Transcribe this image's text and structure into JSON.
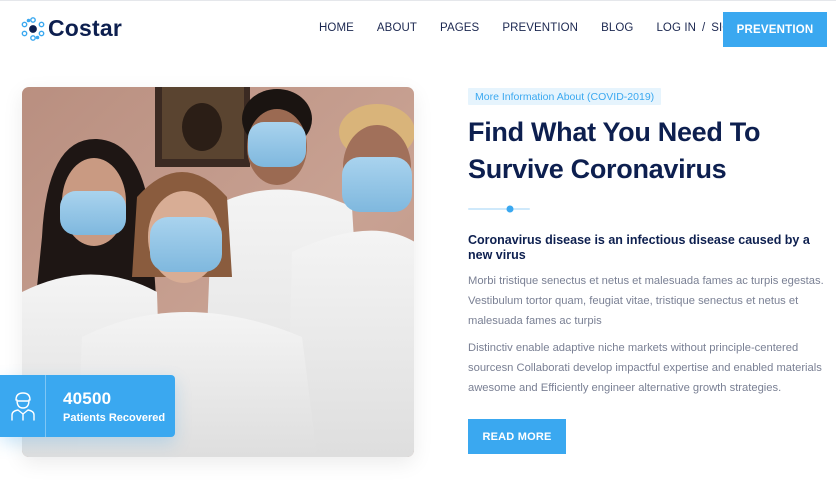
{
  "brand": {
    "name": "Costar",
    "icon": "molecule-logo-icon"
  },
  "nav": {
    "items": [
      {
        "label": "HOME"
      },
      {
        "label": "ABOUT"
      },
      {
        "label": "PAGES"
      },
      {
        "label": "PREVENTION"
      },
      {
        "label": "BLOG"
      }
    ],
    "login": "LOG IN",
    "separator": "/",
    "signup": "SIGN IN",
    "cta": "PREVENTION"
  },
  "stat": {
    "number": "40500",
    "label": "Patients Recovered",
    "icon": "doctor-icon"
  },
  "content": {
    "tag": "More Information About (COVID-2019)",
    "title_line1": "Find What You Need To",
    "title_line2": "Survive Coronavirus",
    "subtitle": "Coronavirus disease is an infectious disease caused by a new virus",
    "paragraph1": "Morbi tristique senectus et netus et malesuada fames ac turpis egestas. Vestibulum tortor quam, feugiat vitae, tristique senectus et netus et malesuada fames ac turpis",
    "paragraph2": "Distinctiv enable adaptive niche markets without principle-centered sourcesn Collaborati develop impactful expertise and enabled materials awesome and Efficiently engineer alternative growth strategies.",
    "button": "READ MORE"
  },
  "colors": {
    "accent": "#3aa8f0",
    "navy": "#0d1f4f",
    "muted": "#7a8094",
    "tag_bg": "#e6f4fd"
  }
}
